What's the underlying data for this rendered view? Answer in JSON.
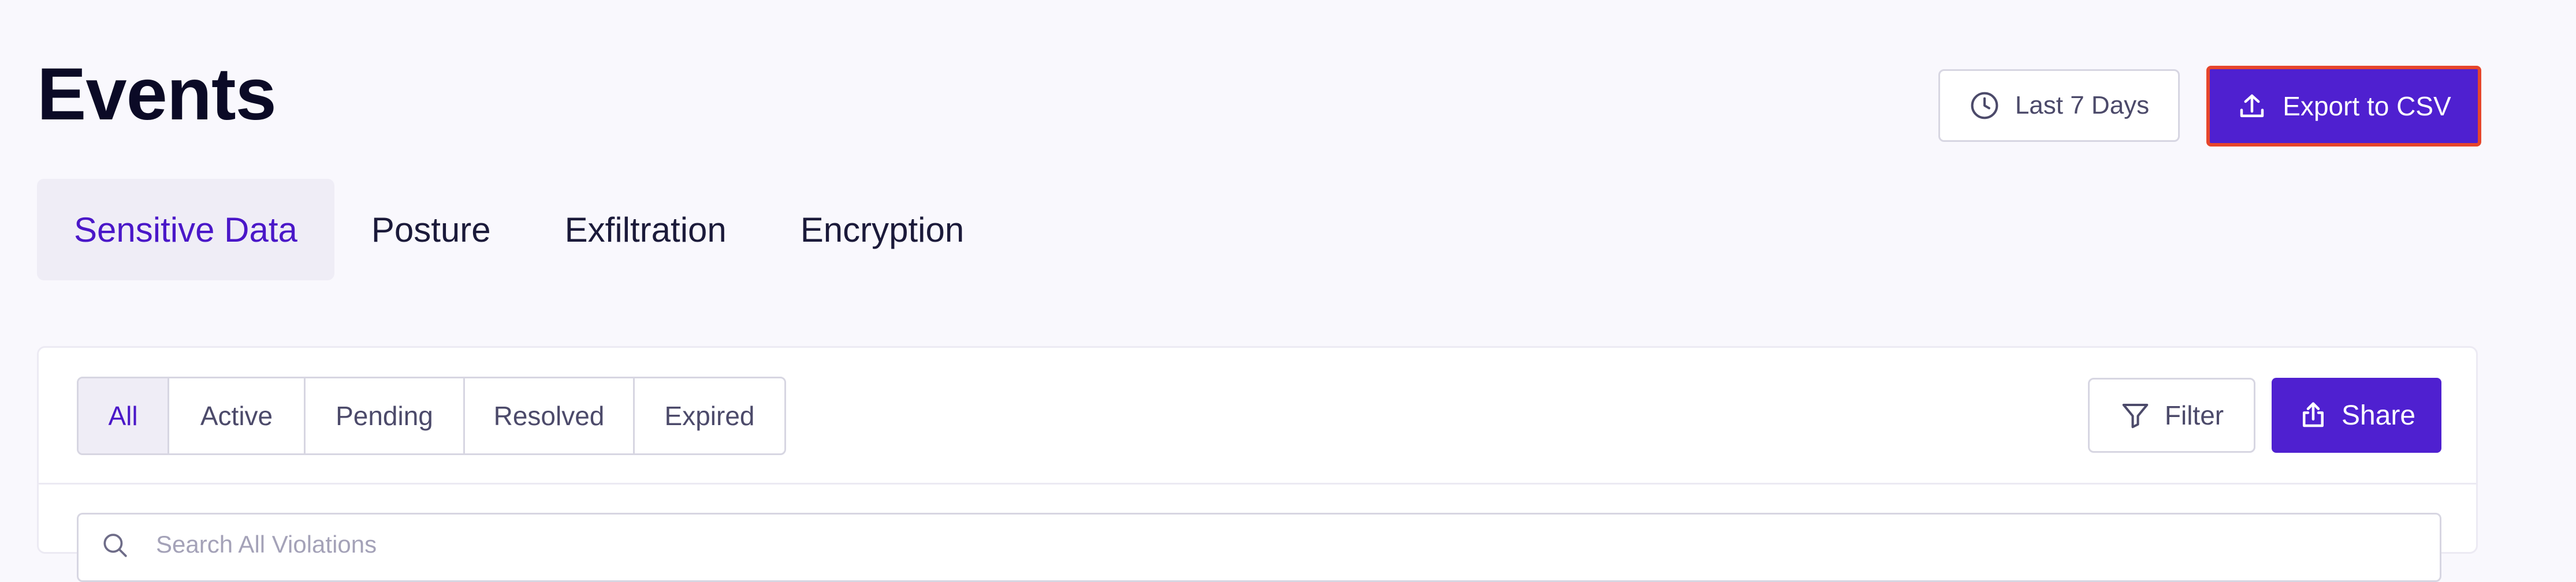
{
  "page": {
    "title": "Events"
  },
  "header": {
    "range_label": "Last 7 Days",
    "range_icon": "clock-icon",
    "export_label": "Export to CSV",
    "export_icon": "upload-icon"
  },
  "tabs": [
    {
      "label": "Sensitive Data",
      "active": true
    },
    {
      "label": "Posture",
      "active": false
    },
    {
      "label": "Exfiltration",
      "active": false
    },
    {
      "label": "Encryption",
      "active": false
    }
  ],
  "status_filter": {
    "options": [
      "All",
      "Active",
      "Pending",
      "Resolved",
      "Expired"
    ],
    "selected": "All"
  },
  "toolbar": {
    "filter_label": "Filter",
    "filter_icon": "funnel-icon",
    "share_label": "Share",
    "share_icon": "share-icon"
  },
  "search": {
    "placeholder": "Search All Violations",
    "value": "",
    "icon": "search-icon"
  },
  "colors": {
    "background": "#f9f8fd",
    "accent": "#4f20d0",
    "accent_text": "#4a17c8",
    "highlight_outline": "#e6452b"
  }
}
